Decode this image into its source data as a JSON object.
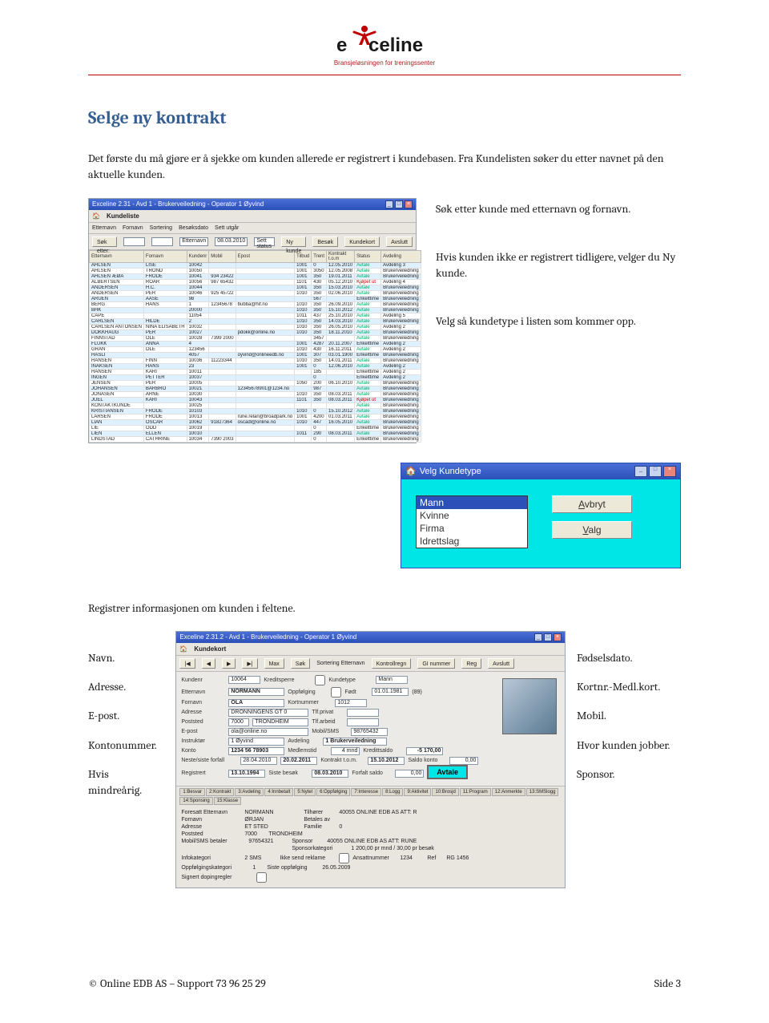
{
  "header": {
    "brand_word_1": "e",
    "brand_word_2": "celine",
    "tagline": "Bransjeløsningen for treningssenter"
  },
  "section_title": "Selge ny kontrakt",
  "intro": "Det første du må gjøre er å sjekke om kunden allerede er registrert i kundebasen. Fra Kundelisten søker du etter navnet på den aktuelle kunden.",
  "side_notes": {
    "n1": "Søk etter kunde med etternavn og fornavn.",
    "n2": "Hvis kunden ikke er registrert tidligere, velger du Ny kunde.",
    "n3": "Velg så kundetype i listen som kommer opp."
  },
  "kundeliste": {
    "title": "Exceline 2.31 - Avd 1 - Brukerveiledning - Operator 1 Øyvind",
    "panel": "Kundeliste",
    "search_labels": {
      "etternavn": "Etternavn",
      "fornavn": "Fornavn",
      "sortering": "Sortering",
      "sortering_val": "Etternavn",
      "besoksdato": "Besøksdato",
      "besoksdato_val": "08.03.2010",
      "sett_utgar": "Sett utgår",
      "sett_status": "Sett status"
    },
    "buttons": {
      "sok": "Søk etter:",
      "nykunde": "Ny kunde",
      "besok": "Besøk",
      "kundekort": "Kundekort",
      "avslutt": "Avslutt"
    },
    "columns": [
      "Etternavn",
      "Fornavn",
      "Kundenr",
      "Mobil",
      "Epost",
      "Tilbud",
      "Trent",
      "Kontrakt t.o.m",
      "Status",
      "Avdeling"
    ],
    "rows": [
      [
        "AHLSEN",
        "LISE",
        "10042",
        "",
        "",
        "1001",
        "0",
        "12.05.2010",
        "Avtale",
        "Avdeling 3"
      ],
      [
        "AHLSEN",
        "TROND",
        "10050",
        "",
        "",
        "1001",
        "3050",
        "12.05.2008",
        "Avtale",
        "Brukerveiledning"
      ],
      [
        "AHLSEN ÆØÅ",
        "FRODE",
        "10041",
        "934 23422",
        "",
        "1001",
        "350",
        "19.01.2011",
        "Avtale",
        "Brukerveiledning"
      ],
      [
        "ALBERTSEN",
        "ROAR",
        "10056",
        "987 65432",
        "",
        "1101",
        "430",
        "05.12.2010",
        "Kjøpet ut",
        "Avdeling 4"
      ],
      [
        "ANDERSEN",
        "H.C.",
        "10044",
        "",
        "",
        "1001",
        "350",
        "15.03.2010",
        "Avtale",
        "Brukerveiledning"
      ],
      [
        "ANDERSEN",
        "PER",
        "10046",
        "925 45722",
        "",
        "1010",
        "350",
        "02.06.2010",
        "Avtale",
        "Brukerveiledning"
      ],
      [
        "ARUEN",
        "AASE",
        "98",
        "",
        "",
        "",
        "567",
        "",
        "Enkelttime",
        "Brukerveiledning"
      ],
      [
        "BERG",
        "HANS",
        "1",
        "12345678",
        "bubba@hif.no",
        "1010",
        "350",
        "26.09.2010",
        "Avtale",
        "Brukerveiledning"
      ],
      [
        "BHK",
        "",
        "20000",
        "",
        "",
        "1010",
        "350",
        "15.10.2012",
        "Avtale",
        "Brukerveiledning"
      ],
      [
        "CAPE",
        "",
        "11054",
        "",
        "",
        "1011",
        "437",
        "25.10.2010",
        "Avtale",
        "Avdeling 5"
      ],
      [
        "CARLSEN",
        "HILDE",
        "2",
        "",
        "",
        "1010",
        "350",
        "14.03.2010",
        "Avtale",
        "Brukerveiledning"
      ],
      [
        "CARLSEN ANTONSEN",
        "NINA ELISABETH",
        "10032",
        "",
        "",
        "1010",
        "350",
        "26.05.2010",
        "Avtale",
        "Avdeling 2"
      ],
      [
        "DOKKHAUG",
        "PER",
        "10027",
        "",
        "pdokk@online.no",
        "1010",
        "350",
        "18.11.2010",
        "Avtale",
        "Brukerveiledning"
      ],
      [
        "FINNSTAD",
        "OLE",
        "10028",
        "7399 2000",
        "",
        "",
        "3457",
        "",
        "Avtale",
        "Brukerveiledning"
      ],
      [
        "FLUKK",
        "ANNA",
        "4",
        "",
        "",
        "1001",
        "4287",
        "20.11.2007",
        "Enkelttime",
        "Avdeling 2"
      ],
      [
        "GRAN",
        "OLE",
        "123456",
        "",
        "",
        "1010",
        "430",
        "16.11.2011",
        "Avtale",
        "Avdeling 2"
      ],
      [
        "HASLI",
        "",
        "4057",
        "",
        "oyvind@onlineedb.no",
        "1001",
        "307",
        "03.01.1900",
        "Enkelttime",
        "Brukerveiledning"
      ],
      [
        "HANSEN",
        "FINN",
        "10036",
        "11223344",
        "",
        "1010",
        "350",
        "14.01.2011",
        "Avtale",
        "Brukerveiledning"
      ],
      [
        "INAKSEN",
        "HANS",
        "23",
        "",
        "",
        "1001",
        "0",
        "12.06.2010",
        "Avtale",
        "Avdeling 2"
      ],
      [
        "HANSEN",
        "KARI",
        "10011",
        "",
        "",
        "",
        "185",
        "",
        "Enkelttime",
        "Avdeling 2"
      ],
      [
        "INGEN",
        "PETTER",
        "10037",
        "",
        "",
        "",
        "0",
        "",
        "Enkelttime",
        "Avdeling 2"
      ],
      [
        "JENSEN",
        "PER",
        "10005",
        "",
        "",
        "1050",
        "200",
        "06.10.2010",
        "Avtale",
        "Brukerveiledning"
      ],
      [
        "JOHANSEN",
        "BARBRO",
        "10021",
        "",
        "12345678901@1234.no",
        "",
        "987",
        "",
        "Avtale",
        "Brukerveiledning"
      ],
      [
        "JONASEN",
        "ARNE",
        "10030",
        "",
        "",
        "1010",
        "350",
        "08.03.2011",
        "Avtale",
        "Brukerveiledning"
      ],
      [
        "JUEL",
        "KARI",
        "10043",
        "",
        "",
        "1101",
        "350",
        "08.03.2011",
        "Kjøpet ut",
        "Brukerveiledning"
      ],
      [
        "KONTAKTKUNDE",
        "",
        "10025",
        "",
        "",
        "",
        "",
        "",
        "Avtale",
        "Brukerveiledning"
      ],
      [
        "KRISTIANSEN",
        "FRODE",
        "10103",
        "",
        "",
        "1010",
        "0",
        "15.10.2012",
        "Avtale",
        "Brukerveiledning"
      ],
      [
        "LARSEN",
        "FRODE",
        "10013",
        "",
        "rune.relan@broadpark.no",
        "1001",
        "4200",
        "01.03.2011",
        "Avtale",
        "Brukerveiledning"
      ],
      [
        "LIAN",
        "OSCAR",
        "10062",
        "91827364",
        "oscadl@online.no",
        "1010",
        "447",
        "16.05.2010",
        "Avtale",
        "Brukerveiledning"
      ],
      [
        "LIE",
        "ODD",
        "10019",
        "",
        "",
        "",
        "0",
        "",
        "Enkelttime",
        "Brukerveiledning"
      ],
      [
        "LIEN",
        "ELLEN",
        "10010",
        "",
        "",
        "1011",
        "290",
        "08.03.2011",
        "Avtale",
        "Brukerveiledning"
      ],
      [
        "LINDSTAD",
        "CATHRINE",
        "10034",
        "7390 2003",
        "",
        "",
        "0",
        "",
        "Enkelttime",
        "Brukerveiledning"
      ]
    ]
  },
  "velg": {
    "title": "Velg Kundetype",
    "options": [
      "Mann",
      "Kvinne",
      "Firma",
      "Idrettslag"
    ],
    "selected": "Mann",
    "btn_avbryt": "Avbryt",
    "btn_valg": "Valg"
  },
  "registrer_heading": "Registrer informasjonen om kunden i feltene.",
  "left_labels": {
    "navn": "Navn.",
    "adresse": "Adresse.",
    "epost": "E-post.",
    "konto": "Kontonummer.",
    "mindre": "Hvis mindreårig."
  },
  "right_labels": {
    "fodsel": "Fødselsdato.",
    "kortnr": "Kortnr.-Medl.kort.",
    "mobil": "Mobil.",
    "jobber": "Hvor kunden jobber.",
    "sponsor": "Sponsor."
  },
  "kundekort": {
    "title": "Exceline 2.31.2 - Avd 1 - Brukerveiledning - Operator 1 Øyvind",
    "panel": "Kundekort",
    "toolbar": {
      "max": "Max",
      "sok": "Søk",
      "sortering": "Sortering Etternavn",
      "kontrollregn": "Kontrollregn",
      "ginumret": "GI nummer",
      "reg": "Reg",
      "avslutt": "Avslutt"
    },
    "fields": {
      "kundenr": "Kundenr",
      "kundenr_v": "10064",
      "kreditsperre": "Kreditsperre",
      "oppfolging": "Oppfølging",
      "kundetype": "Kundetype",
      "kundetype_v": "Mann",
      "etternavn": "Etternavn",
      "etternavn_v": "NORMANN",
      "fornavn": "Fornavn",
      "fornavn_v": "OLA",
      "fodt": "Født",
      "fodt_v": "01.01.1981",
      "alder": "(89)",
      "kortnr": "Kortnummer",
      "kortnr_v": "1012",
      "adresse": "Adresse",
      "adresse_v": "DRONNINGENS GT 0",
      "tlfpriv": "Tlf.privat",
      "tlfarb": "Tlf.arbeid",
      "poststed": "Poststed",
      "post_v1": "7000",
      "post_v2": "TRONDHEIM",
      "epost": "E-post",
      "epost_v": "ola@online.no",
      "mobilsms": "Mobil/SMS",
      "mobil_v": "98765432",
      "instruktor": "Instruktør",
      "instr_v": "1 Øyvind",
      "avdeling": "Avdeling",
      "avd_v": "1 Brukerveiledning",
      "konto": "Konto",
      "konto_v": "1234 56 78903",
      "medlemstid": "Medlemstid",
      "medlemstid_v": "4 mnd",
      "kredittsaldo": "Kredittsaldo",
      "kredittsaldo_v": "-5 170,00",
      "nesteforfall": "Neste/siste forfall",
      "nesteforfall_v1": "28.04.2010",
      "nesteforfall_v2": "20.02.2011",
      "kontrakt": "Kontrakt t.o.m.",
      "kontrakt_v": "15.10.2012",
      "saldokonto": "Saldo konto",
      "saldokonto_v": "0,00",
      "registrert": "Registrert",
      "registrert_v": "13.10.1994",
      "siste": "Siste besøk",
      "siste_v": "08.03.2010",
      "forfalt": "Forfalt saldo",
      "forfalt_v": "0,00",
      "avtale": "Avtale"
    },
    "tabs": [
      "1:Besvar",
      "2:Kontrakt",
      "3:Avdeling",
      "4:Innbetalt",
      "5:Nytel",
      "6:Oppfølging",
      "7:Interesse",
      "8:Logg",
      "9:Aktivitet",
      "10:Brosjd",
      "11:Program",
      "12:Anmerkte",
      "13:SMSlogg",
      "14:Sponsing",
      "15:Klasse"
    ],
    "foresatt": {
      "etternavn": "Foresatt Etternavn",
      "etternavn_v": "NORMANN",
      "fornavn": "Fornavn",
      "fornavn_v": "ØRJAN",
      "adresse": "Adresse",
      "adresse_v": "ET STED",
      "poststed": "Poststed",
      "post_v1": "7000",
      "post_v2": "TRONDHEIM",
      "mobil": "Mobil/SMS betaler",
      "mobil_v": "97654321",
      "tilhorer": "Tilhører",
      "tilhorer_v": "40055  ONLINE EDB AS ATT: R",
      "betales": "Betales av",
      "familie": "Familie",
      "familie_v": "0",
      "sponsor": "Sponsor",
      "sponsor_v": "40055  ONLINE EDB AS ATT: RUNE",
      "sponsorkat": "Sponsorkategori",
      "sponsorkat_v": "1  200,00 pr mnd / 30,00 pr besøk",
      "infokat": "Infokategori",
      "infokat_v": "2  SMS",
      "ikke": "Ikke send reklame",
      "ansatt": "Ansattnummer",
      "ansatt_v": "1234",
      "ref": "Ref",
      "ref_v": "RG 1456",
      "oppfolgkat": "Oppfølgingskategori",
      "oppfolgkat_v": "1",
      "sisteoppf": "Siste oppfølging",
      "sisteoppf_v": "26.05.2009",
      "signert": "Signert dopingregler"
    }
  },
  "footer": {
    "left": "© Online EDB AS – Support 73 96 25 29",
    "right": "Side 3"
  }
}
